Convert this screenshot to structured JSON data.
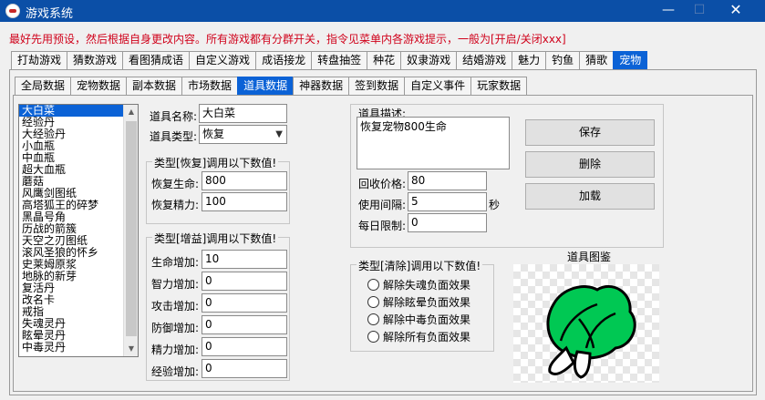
{
  "window": {
    "title": "游戏系统",
    "minimize_icon": "minimize-icon",
    "maximize_icon": "maximize-icon",
    "close_icon": "close-icon"
  },
  "notice": "最好先用预设，然后根据自身更改内容。所有游戏都有分群开关，指令见菜单内各游戏提示，一般为[开启/关闭xxx]",
  "main_tabs": [
    {
      "label": "打劫游戏"
    },
    {
      "label": "猜数游戏"
    },
    {
      "label": "看图猜成语"
    },
    {
      "label": "自定义游戏"
    },
    {
      "label": "成语接龙"
    },
    {
      "label": "转盘抽签"
    },
    {
      "label": "种花"
    },
    {
      "label": "奴隶游戏"
    },
    {
      "label": "结婚游戏"
    },
    {
      "label": "魅力"
    },
    {
      "label": "钓鱼"
    },
    {
      "label": "猜歌"
    },
    {
      "label": "宠物",
      "active": true
    }
  ],
  "sub_tabs": [
    {
      "label": "全局数据"
    },
    {
      "label": "宠物数据"
    },
    {
      "label": "副本数据"
    },
    {
      "label": "市场数据"
    },
    {
      "label": "道具数据",
      "active": true
    },
    {
      "label": "神器数据"
    },
    {
      "label": "签到数据"
    },
    {
      "label": "自定义事件"
    },
    {
      "label": "玩家数据"
    }
  ],
  "item_list": {
    "selected": "大白菜",
    "items": [
      "大白菜",
      "经验丹",
      "大经验丹",
      "小血瓶",
      "中血瓶",
      "超大血瓶",
      "蘑菇",
      "风鹰剑图纸",
      "高塔狐王的碎梦",
      "黑晶号角",
      "历战的箭簇",
      "天空之刃图纸",
      "滚风圣狼的怀乡",
      "史莱姆原浆",
      "地脉的新芽",
      "复活丹",
      "改名卡",
      "戒指",
      "失魂灵丹",
      "眩晕灵丹",
      "中毒灵丹"
    ]
  },
  "item_form": {
    "name_label": "道具名称:",
    "name_value": "大白菜",
    "type_label": "道具类型:",
    "type_value": "恢复"
  },
  "restore_group": {
    "title": "类型[恢复]调用以下数值!",
    "hp_label": "恢复生命:",
    "hp_value": "800",
    "mp_label": "恢复精力:",
    "mp_value": "100"
  },
  "buff_group": {
    "title": "类型[增益]调用以下数值!",
    "fields": [
      {
        "label": "生命增加:",
        "value": "10"
      },
      {
        "label": "智力增加:",
        "value": "0"
      },
      {
        "label": "攻击增加:",
        "value": "0"
      },
      {
        "label": "防御增加:",
        "value": "0"
      },
      {
        "label": "精力增加:",
        "value": "0"
      },
      {
        "label": "经验增加:",
        "value": "0"
      }
    ]
  },
  "desc_group": {
    "title": "道具描述:",
    "description": "恢复宠物800生命",
    "sell_label": "回收价格:",
    "sell_value": "80",
    "interval_label": "使用间隔:",
    "interval_value": "5",
    "interval_unit": "秒",
    "daily_label": "每日限制:",
    "daily_value": "0"
  },
  "buttons": {
    "save": "保存",
    "delete": "删除",
    "load": "加载"
  },
  "clear_group": {
    "title": "类型[清除]调用以下数值!",
    "options": [
      "解除失魂负面效果",
      "解除眩晕负面效果",
      "解除中毒负面效果",
      "解除所有负面效果"
    ]
  },
  "preview": {
    "label": "道具图鉴",
    "image_icon": "cabbage-icon",
    "colors": {
      "leaf": "#00c853",
      "outline": "#000000",
      "stem": "#ffffff"
    }
  }
}
